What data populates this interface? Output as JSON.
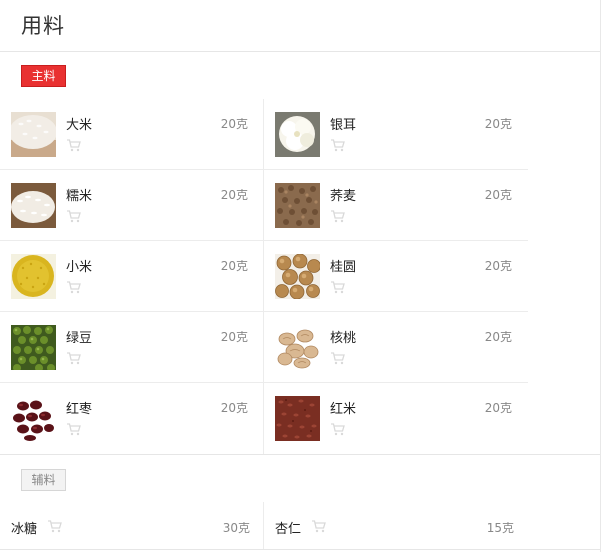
{
  "header": {
    "title": "用料"
  },
  "main_section": {
    "tag": "主料",
    "rows": [
      {
        "left": {
          "name": "大米",
          "amount": "20克",
          "image": "rice"
        },
        "right": {
          "name": "银耳",
          "amount": "20克",
          "image": "white-fungus"
        }
      },
      {
        "left": {
          "name": "糯米",
          "amount": "20克",
          "image": "glutinous-rice"
        },
        "right": {
          "name": "荞麦",
          "amount": "20克",
          "image": "buckwheat"
        }
      },
      {
        "left": {
          "name": "小米",
          "amount": "20克",
          "image": "millet"
        },
        "right": {
          "name": "桂圆",
          "amount": "20克",
          "image": "longan"
        }
      },
      {
        "left": {
          "name": "绿豆",
          "amount": "20克",
          "image": "mung-bean"
        },
        "right": {
          "name": "核桃",
          "amount": "20克",
          "image": "walnut"
        }
      },
      {
        "left": {
          "name": "红枣",
          "amount": "20克",
          "image": "red-date"
        },
        "right": {
          "name": "红米",
          "amount": "20克",
          "image": "red-rice"
        }
      }
    ]
  },
  "aux_section": {
    "tag": "辅料",
    "items": [
      {
        "name": "冰糖",
        "amount": "30克"
      },
      {
        "name": "杏仁",
        "amount": "15克"
      }
    ]
  },
  "colors": {
    "main_tag_bg": "#e93131",
    "aux_tag_bg": "#f3f3f3",
    "divider": "#ececec"
  }
}
